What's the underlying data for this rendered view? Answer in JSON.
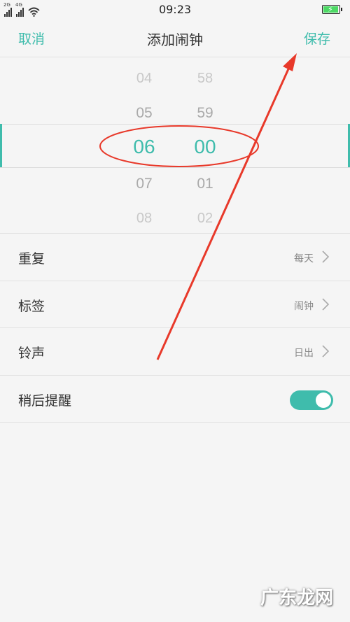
{
  "status_bar": {
    "time": "09:23",
    "signal1_tag": "2G",
    "signal2_tag": "4G"
  },
  "header": {
    "cancel_label": "取消",
    "title": "添加闹钟",
    "save_label": "保存"
  },
  "picker": {
    "hours": [
      "04",
      "05",
      "06",
      "07",
      "08"
    ],
    "minutes": [
      "58",
      "59",
      "00",
      "01",
      "02"
    ],
    "selected_hour": "06",
    "selected_minute": "00"
  },
  "settings": {
    "repeat": {
      "label": "重复",
      "value": "每天"
    },
    "tag": {
      "label": "标签",
      "value": "闹钟"
    },
    "ringtone": {
      "label": "铃声",
      "value": "日出"
    },
    "snooze": {
      "label": "稍后提醒",
      "enabled": true
    }
  },
  "watermark": "广东龙网",
  "colors": {
    "accent": "#3fbcac",
    "annotation": "#e8392a",
    "background": "#f5f5f5"
  }
}
